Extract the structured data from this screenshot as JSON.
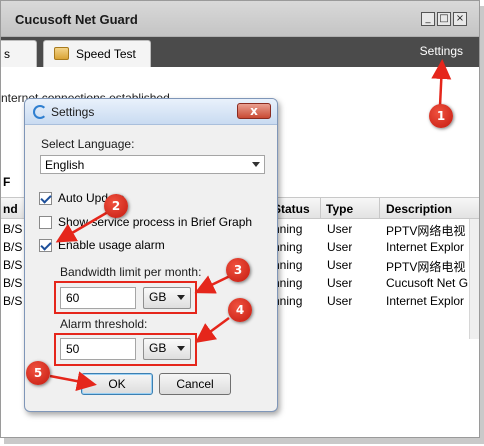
{
  "app": {
    "title": "Cucusoft Net Guard",
    "window_buttons": [
      "_",
      "□",
      "×"
    ],
    "tabs": [
      {
        "label": "s"
      },
      {
        "label": "Speed Test"
      }
    ],
    "settings_link": "Settings",
    "connection_message": "nternet connections established",
    "grid": {
      "columns": [
        "nd",
        "Status",
        "Type",
        "Description"
      ],
      "rows": [
        {
          "c0": "B/S",
          "status": "nning",
          "type": "User",
          "desc": "PPTV网络电视"
        },
        {
          "c0": "B/S",
          "status": "nning",
          "type": "User",
          "desc": "Internet Explor"
        },
        {
          "c0": "B/S",
          "status": "nning",
          "type": "User",
          "desc": "PPTV网络电视"
        },
        {
          "c0": "B/S",
          "status": "nning",
          "type": "User",
          "desc": "Cucusoft Net G"
        },
        {
          "c0": "B/S",
          "status": "nning",
          "type": "User",
          "desc": "Internet Explor"
        }
      ],
      "stub_letter": "F"
    }
  },
  "dialog": {
    "title": "Settings",
    "close_glyph": "x",
    "language_label": "Select Language:",
    "language_value": "English",
    "auto_update_label": "Auto Update",
    "auto_update_checked": true,
    "show_service_label": "Show service process in Brief Graph",
    "show_service_checked": false,
    "usage_alarm_label": "Enable usage alarm",
    "usage_alarm_checked": true,
    "bandwidth_label": "Bandwidth limit per month:",
    "bandwidth_value": "60",
    "bandwidth_unit": "GB",
    "threshold_label": "Alarm threshold:",
    "threshold_value": "50",
    "threshold_unit": "GB",
    "ok_label": "OK",
    "cancel_label": "Cancel"
  },
  "annotations": {
    "badges": [
      "1",
      "2",
      "3",
      "4",
      "5"
    ],
    "color": "#e5261b"
  }
}
